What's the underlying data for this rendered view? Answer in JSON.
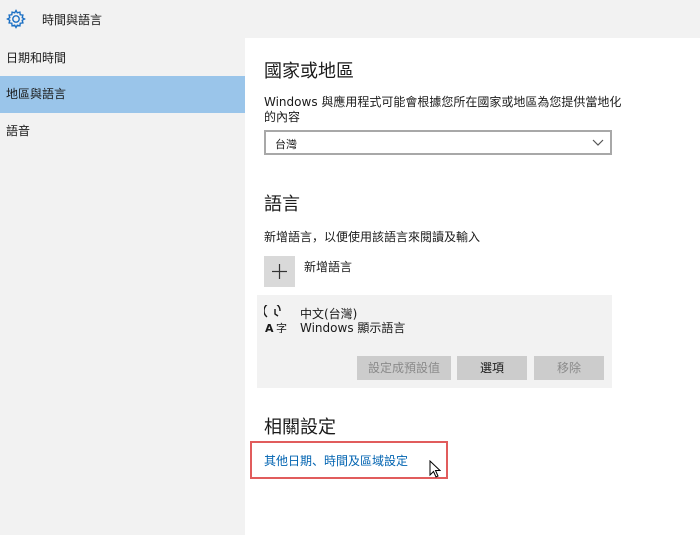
{
  "window": {
    "title": "時間與語言",
    "icon": "gear-icon"
  },
  "sidebar": {
    "items": [
      {
        "label": "日期和時間",
        "selected": false
      },
      {
        "label": "地區與語言",
        "selected": true
      },
      {
        "label": "語音",
        "selected": false
      }
    ]
  },
  "region": {
    "heading": "國家或地區",
    "description_line1": "Windows 與應用程式可能會根據您所在國家或地區為您提供當地化",
    "description_line2": "的內容",
    "selected_country": "台灣"
  },
  "language": {
    "heading": "語言",
    "description": "新增語言，以便使用該語言來閱讀及輸入",
    "add_label": "新增語言",
    "entry": {
      "name": "中文(台灣)",
      "subtitle": "Windows 顯示語言",
      "icon": "language-az-icon",
      "buttons": {
        "set_default": "設定成預設值",
        "options": "選項",
        "remove": "移除"
      }
    }
  },
  "related": {
    "heading": "相關設定",
    "link": "其他日期、時間及區域設定"
  },
  "colors": {
    "accent": "#0063b1",
    "selection": "#9ac5ea",
    "highlight_border": "#e15c5c"
  }
}
